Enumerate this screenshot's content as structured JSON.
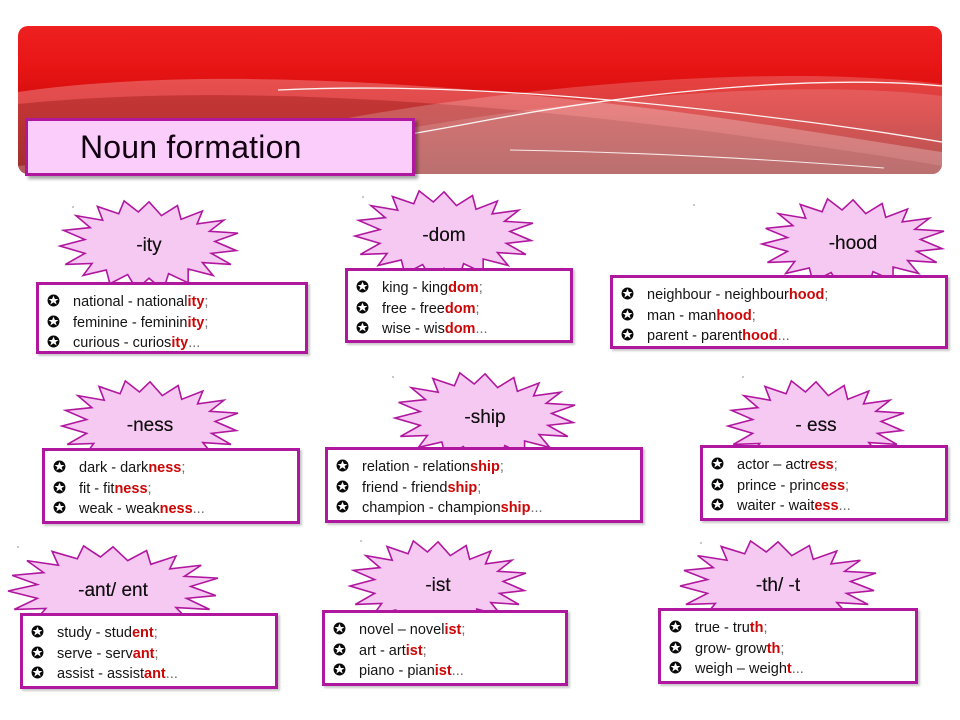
{
  "slide": {
    "title": "Noun formation",
    "accent_magenta": "#b0179f",
    "accent_red": "#cc0707",
    "burst_fill": "#f6c9f2",
    "banner_red": "#d00b0b",
    "title_plate_bg": "#fbcdfb"
  },
  "bullet_icon": "star-in-circle-bullet",
  "cards": [
    {
      "id": "ity",
      "suffix": "-ity",
      "items": [
        {
          "stem": "national - national",
          "suffix": "ity",
          "tail": ";"
        },
        {
          "stem": "feminine - feminin",
          "suffix": "ity",
          "tail": ";"
        },
        {
          "stem": "curious - curios",
          "suffix": "ity",
          "tail": "..."
        }
      ]
    },
    {
      "id": "dom",
      "suffix": "-dom",
      "items": [
        {
          "stem": "king - king",
          "suffix": "dom",
          "tail": ";"
        },
        {
          "stem": "free - free",
          "suffix": "dom",
          "tail": ";"
        },
        {
          "stem": "wise - wis",
          "suffix": "dom",
          "tail": "..."
        }
      ]
    },
    {
      "id": "hood",
      "suffix": "-hood",
      "items": [
        {
          "stem": "neighbour  - neighbour",
          "suffix": "hood",
          "tail": ";"
        },
        {
          "stem": "man - man",
          "suffix": "hood",
          "tail": ";"
        },
        {
          "stem": "parent - parent",
          "suffix": "hood",
          "tail": "..."
        }
      ]
    },
    {
      "id": "ness",
      "suffix": "-ness",
      "items": [
        {
          "stem": "dark - dark",
          "suffix": "ness",
          "tail": ";"
        },
        {
          "stem": "fit - fit",
          "suffix": "ness",
          "tail": ";"
        },
        {
          "stem": "weak - weak",
          "suffix": "ness",
          "tail": "..."
        }
      ]
    },
    {
      "id": "ship",
      "suffix": "-ship",
      "items": [
        {
          "stem": "relation - relation",
          "suffix": "ship",
          "tail": ";"
        },
        {
          "stem": "friend - friend",
          "suffix": "ship",
          "tail": ";"
        },
        {
          "stem": "champion - champion",
          "suffix": "ship",
          "tail": "..."
        }
      ]
    },
    {
      "id": "ess",
      "suffix": "- ess",
      "items": [
        {
          "stem": "actor – actr",
          "suffix": "ess",
          "tail": ";"
        },
        {
          "stem": "prince - princ",
          "suffix": "ess",
          "tail": ";"
        },
        {
          "stem": "waiter - wait",
          "suffix": "ess",
          "tail": "..."
        }
      ]
    },
    {
      "id": "ant-ent",
      "suffix": "-ant/ ent",
      "items": [
        {
          "stem": "study - stud",
          "suffix": "ent",
          "tail": ";"
        },
        {
          "stem": "serve - serv",
          "suffix": "ant",
          "tail": ";"
        },
        {
          "stem": "assist - assist",
          "suffix": "ant",
          "tail": "..."
        }
      ]
    },
    {
      "id": "ist",
      "suffix": "-ist",
      "items": [
        {
          "stem": "novel – novel",
          "suffix": "ist",
          "tail": ";"
        },
        {
          "stem": "art - art",
          "suffix": "ist",
          "tail": ";"
        },
        {
          "stem": "piano - pian",
          "suffix": "ist",
          "tail": "..."
        }
      ]
    },
    {
      "id": "th-t",
      "suffix": "-th/ -t",
      "items": [
        {
          "stem": "true - tru",
          "suffix": "th",
          "tail": ";"
        },
        {
          "stem": "grow- grow",
          "suffix": "th",
          "tail": ";"
        },
        {
          "stem": "weigh – weigh",
          "suffix": "t",
          "tail": "..."
        }
      ]
    }
  ]
}
